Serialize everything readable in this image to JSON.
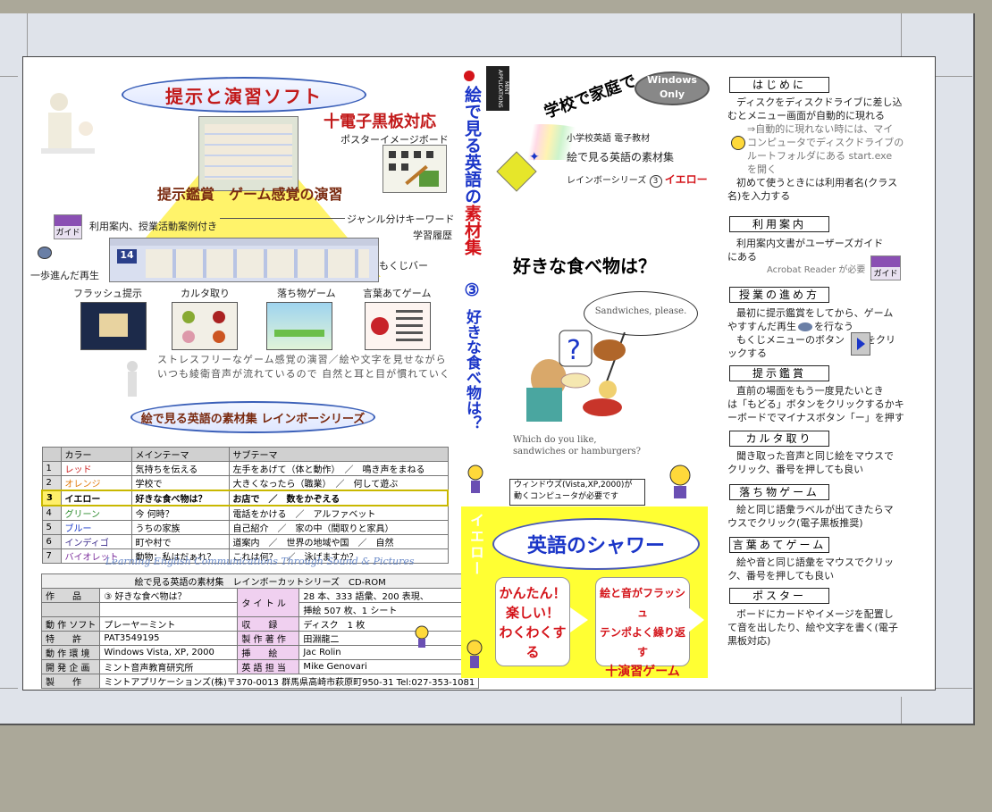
{
  "left": {
    "title": "提示と演習ソフト",
    "ewb": "十電子黒板対応",
    "poster_board": "ポスターイメージボード",
    "pyramid_text": "提示鑑賞　ゲーム感覚の演習",
    "guide_note": "利用案内、授業活動案例付き",
    "guide_label": "ガイド",
    "genre_kw": "ジャンル分けキーワード",
    "history": "学習履歴",
    "step_back": "一歩進んだ再生",
    "mokuji": "もくじバー",
    "shot_num": "14",
    "thumb_labels": [
      "フラッシュ提示",
      "カルタ取り",
      "落ち物ゲーム",
      "言葉あてゲーム"
    ],
    "stressfree": [
      "ストレスフリーなゲーム感覚の演習／絵や文字を見せながら",
      "いつも綾衛音声が流れているので 自然と耳と目が慣れていく"
    ],
    "series_title": "絵で見る英語の素材集 レインボーシリーズ"
  },
  "series_table": {
    "headers": [
      "カラー",
      "メインテーマ",
      "サブテーマ"
    ],
    "rows": [
      {
        "no": "1",
        "color": "レッド",
        "main": "気持ちを伝える",
        "sub": "左手をあげて（体と動作）　／　鳴き声をまねる"
      },
      {
        "no": "2",
        "color": "オレンジ",
        "main": "学校で",
        "sub": "大きくなったら（職業）　／　何して遊ぶ"
      },
      {
        "no": "3",
        "color": "イエロー",
        "main": "好きな食べ物は？",
        "sub": "お店で　／　数をかぞえる"
      },
      {
        "no": "4",
        "color": "グリーン",
        "main": "今 何時？",
        "sub": "電話をかける　／　アルファベット"
      },
      {
        "no": "5",
        "color": "ブルー",
        "main": "うちの家族",
        "sub": "自己紹介　／　家の中（間取りと家具）"
      },
      {
        "no": "6",
        "color": "インディゴ",
        "main": "町や村で",
        "sub": "道案内　／　世界の地域や国　／　自然"
      },
      {
        "no": "7",
        "color": "バイオレット",
        "main": "動物：私はだぁれ？",
        "sub": "これは何？　／　泳げますか？"
      }
    ]
  },
  "tagline": "Learning English Communications Through Sound & Pictures",
  "spec": {
    "header": "絵で見る英語の素材集　レインボーカットシリーズ　CD-ROM",
    "product_k": "作　　品",
    "product_v": "③ 好きな食べ物は？",
    "title_k": "タ イ ト ル",
    "title_v1": "28 本、333 語彙、200 表現、",
    "title_v2": "挿絵 507 枚、1 シート",
    "soft_k": "動 作 ソフト",
    "soft_v": "プレーヤーミント",
    "rec_k": "収　　録",
    "rec_v": "ディスク　1 枚",
    "patent_k": "特　　許",
    "patent_v": "PAT3549195",
    "prod_k": "製 作 著 作",
    "prod_v": "田淵龍二",
    "env_k": "動 作 環 境",
    "env_v": "Windows Vista, XP, 2000",
    "illus_k": "挿　　絵",
    "illus_v": "Jac Rolin",
    "dev_k": "開 発 企 画",
    "dev_v": "ミント音声教育研究所",
    "eng_k": "英 語 担 当",
    "eng_v": "Mike Genovari",
    "maker_k": "製　　作",
    "maker_v": "ミントアプリケーションズ(株)〒370-0013 群馬県高崎市萩原町950-31 Tel:027-353-1081"
  },
  "middle": {
    "spine": [
      "絵で見る英語の",
      "素材集",
      "③",
      "好きな食べ物は？"
    ],
    "mint": "MINT APPLICATIONS",
    "school_home": "学校で家庭で",
    "windows_only": "Windows Only",
    "elem": "小学校英語 電子教材",
    "sozai": "絵で見る英語の素材集",
    "rainbow_series": "レインボーシリーズ",
    "rainbow_num": "3",
    "yellow": "イエロー",
    "food_q": "好きな食べ物は？",
    "bubble": "Sandwiches, please.",
    "which": [
      "Which do you like,",
      "sandwiches or hamburgers?"
    ],
    "qmark": "?",
    "req": [
      "ウィンドウズ(Vista,XP,2000)が",
      "動くコンピュータが必要です"
    ],
    "yellow_v": "イエロー",
    "shower": "英語のシャワー",
    "box1": [
      "かんたん！",
      "楽しい！",
      "わくわくする"
    ],
    "box2": [
      "絵と音がフラッシュ",
      "テンポよく繰り返す",
      "十演習ゲーム"
    ]
  },
  "right": {
    "sections": [
      {
        "title": "はじめに",
        "lines": [
          "ディスクをディスクドライブに差し込",
          "むとメニュー画面が自動的に現れる"
        ]
      },
      {
        "title": "利用案内",
        "lines": [
          "利用案内文書がユーザーズガイド",
          "にある"
        ]
      },
      {
        "title": "授業の進め方",
        "lines": [
          "最初に提示鑑賞をしてから、ゲーム",
          "やすすんだ再生",
          "を行なう",
          "もくじメニューのボタン",
          "をクリ",
          "ックする"
        ]
      },
      {
        "title": "提示鑑賞",
        "lines": [
          "直前の場面をもう一度見たいとき",
          "は「もどる」ボタンをクリックするかキ",
          "ーボードでマイナスボタン「ー」を押す"
        ]
      },
      {
        "title": "カルタ取り",
        "lines": [
          "聞き取った音声と同じ絵をマウスで",
          "クリック、番号を押しても良い"
        ]
      },
      {
        "title": "落ち物ゲーム",
        "lines": [
          "絵と同じ語彙ラベルが出てきたらマ",
          "ウスでクリック(電子黒板推奨)"
        ]
      },
      {
        "title": "言葉あてゲーム",
        "lines": [
          "絵や音と同じ語彙をマウスでクリッ",
          "ク、番号を押しても良い"
        ]
      },
      {
        "title": "ポスター",
        "lines": [
          "ボードにカードやイメージを配置し",
          "て音を出したり、絵や文字を書く(電子",
          "黒板対応)"
        ]
      }
    ],
    "faint1": [
      "⇒自動的に現れない時には、マイ",
      "コンピュータでディスクドライブの",
      "ルートフォルダにある start.exe",
      "を開く"
    ],
    "hajime_extra": [
      "初めて使うときには利用者名(クラス",
      "名)を入力する"
    ],
    "acrobat": "Acrobat Reader が必要",
    "guide": "ガイド"
  },
  "colors": {
    "yellow": "#ffff33",
    "red": "#d4141a",
    "blue": "#1a35c8",
    "green": "#2e8b2e"
  }
}
